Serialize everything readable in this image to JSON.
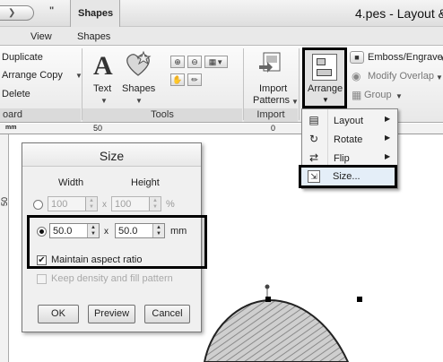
{
  "titlebar": {
    "context_tab": "Shapes",
    "window_title": "4.pes - Layout &",
    "qat_more": "\""
  },
  "tabs": [
    {
      "label": "View"
    },
    {
      "label": "Shapes"
    }
  ],
  "ribbon": {
    "edit_items": [
      "Duplicate",
      "Arrange Copy",
      "Delete"
    ],
    "edit_group": "oard",
    "text_label": "Text",
    "shapes_label": "Shapes",
    "tools_group": "Tools",
    "import_label_1": "Import",
    "import_label_2": "Patterns",
    "import_group": "Import",
    "arrange_label": "Arrange",
    "right_items": [
      "Emboss/Engrave",
      "Modify Overlap",
      "Group"
    ]
  },
  "ruler": {
    "unit": "mm",
    "marks": [
      "50",
      "0"
    ],
    "v_mark": "50"
  },
  "arrange_menu": {
    "items": [
      {
        "label": "Layout"
      },
      {
        "label": "Rotate"
      },
      {
        "label": "Flip"
      }
    ],
    "size_label": "Size..."
  },
  "size_dialog": {
    "title": "Size",
    "width_header": "Width",
    "height_header": "Height",
    "percent_width": "100",
    "percent_height": "100",
    "percent_unit": "%",
    "mm_width": "50.0",
    "mm_height": "50.0",
    "mm_unit": "mm",
    "times": "x",
    "maintain_aspect_label": "Maintain aspect ratio",
    "maintain_aspect_checked": true,
    "keep_density_label": "Keep density and fill pattern",
    "keep_density_checked": false,
    "ok_label": "OK",
    "preview_label": "Preview",
    "cancel_label": "Cancel"
  }
}
